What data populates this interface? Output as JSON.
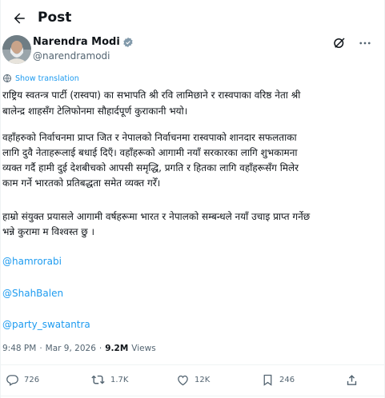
{
  "header": {
    "title": "Post"
  },
  "author": {
    "name": "Narendra Modi",
    "handle": "@narendramodi"
  },
  "tweet": {
    "show_translation": "Show translation",
    "lines": [
      "राष्ट्रिय स्वतन्त्र पार्टी (रास्वपा) का सभापति श्री रवि लामिछाने र  रास्वपाका वरिष्ठ नेता श्री",
      "बालेन्द्र शाहसँग टेलिफोनमा सौहार्दपूर्ण कुराकानी भयो।",
      "वहाँहरुको निर्वाचनमा प्राप्त जित र नेपालको निर्वाचनमा रास्वपाको शानदार सफलताका",
      "लागि दुवै नेताहरूलाई बधाई दिएँ। वहाँहरूको आगामी नयाँ सरकारका लागि शुभकामना",
      "व्यक्त गर्दै हामी दुई देशबीचको आपसी समृद्धि, प्रगति र हितका लागि वहाँहरूसँग मिलेर",
      "काम गर्ने भारतको प्रतिबद्धता समेत व्यक्त गरेँ।",
      "हाम्रो संयुक्त प्रयासले आगामी वर्षहरूमा भारत र नेपालको सम्बन्धले नयाँ उचाइ प्राप्त गर्नेछ",
      "भन्ने कुरामा म विश्वस्त छु ।"
    ],
    "mentions": [
      "@hamrorabi",
      "@ShahBalen",
      "@party_swatantra"
    ]
  },
  "meta": {
    "time": "9:48 PM",
    "sep1": "·",
    "date": "Mar 9, 2026",
    "sep2": "·",
    "views_count": "9.2M",
    "views_label": "Views"
  },
  "actions": {
    "replies": "726",
    "reposts": "1.7K",
    "likes": "12K",
    "bookmarks": "246"
  },
  "colors": {
    "accent": "#1d9bf0",
    "muted": "#536471",
    "text": "#0f1419",
    "verified": "#829aab"
  }
}
